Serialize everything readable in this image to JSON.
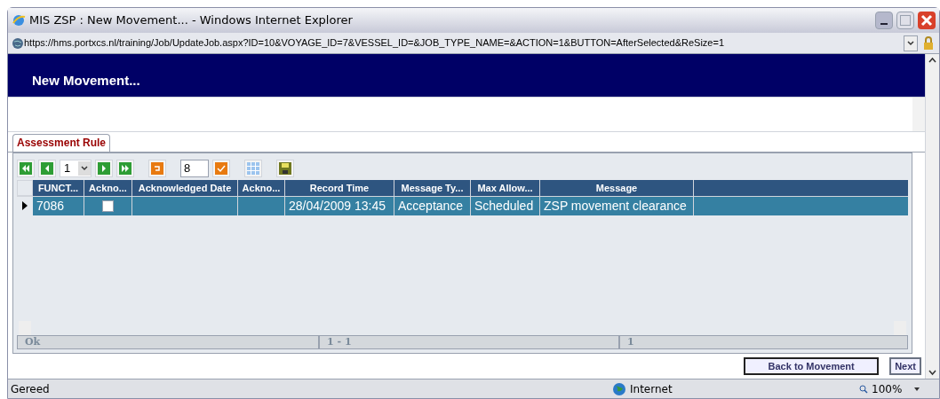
{
  "window": {
    "title": "MIS ZSP : New Movement... - Windows Internet Explorer"
  },
  "address_bar": {
    "url": "https://hms.portxcs.nl/training/Job/UpdateJob.aspx?ID=10&VOYAGE_ID=7&VESSEL_ID=&JOB_TYPE_NAME=&ACTION=1&BUTTON=AfterSelected&ReSize=1"
  },
  "page_header": {
    "title": "New Movement..."
  },
  "tabs": [
    {
      "label": "Assessment Rule",
      "selected": true
    }
  ],
  "pager": {
    "page": "1",
    "page_size": "8"
  },
  "grid": {
    "columns": [
      "FUNCT...",
      "Ackno...",
      "Acknowledged Date",
      "Ackno...",
      "Record Time",
      "Message Ty...",
      "Max Allow...",
      "Message"
    ],
    "rows": [
      {
        "selected": true,
        "acknowledged": false,
        "cells": [
          "7086",
          "",
          "",
          "",
          "28/04/2009 13:45",
          "Acceptance",
          "Scheduled",
          "ZSP movement clearance"
        ]
      }
    ],
    "footer": [
      "Ok",
      "1 - 1",
      "1"
    ]
  },
  "buttons": [
    "Back to Movement",
    "Next"
  ],
  "status_bar": {
    "text": "Gereed",
    "zone": "Internet",
    "zoom": "100%"
  }
}
